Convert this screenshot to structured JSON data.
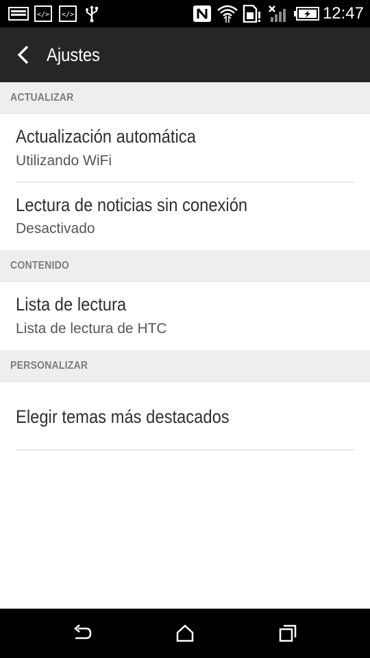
{
  "status_bar": {
    "time": "12:47",
    "left_icons": [
      "image-icon",
      "code-icon",
      "code-icon",
      "usb-icon"
    ],
    "right_icons": [
      "nfc-icon",
      "wifi-icon",
      "sim-alert-icon",
      "no-signal-icon",
      "battery-charging-icon"
    ]
  },
  "app_bar": {
    "title": "Ajustes",
    "back_icon": "back-arrow-icon"
  },
  "sections": {
    "actualizar": {
      "header": "ACTUALIZAR",
      "items": [
        {
          "title": "Actualización automática",
          "subtitle": "Utilizando WiFi"
        },
        {
          "title": "Lectura de noticias sin conexión",
          "subtitle": "Desactivado"
        }
      ]
    },
    "contenido": {
      "header": "CONTENIDO",
      "items": [
        {
          "title": "Lista de lectura",
          "subtitle": "Lista de lectura de HTC"
        }
      ]
    },
    "personalizar": {
      "header": "PERSONALIZAR",
      "items": [
        {
          "title": "Elegir temas más destacados"
        }
      ]
    }
  },
  "nav_bar": {
    "buttons": [
      "back-icon",
      "home-icon",
      "recents-icon"
    ]
  },
  "colors": {
    "app_bar_bg": "#262626",
    "section_bg": "#eeeeee",
    "section_text": "#7d7d7d",
    "title_text": "#2f2f2f",
    "subtitle_text": "#555555"
  }
}
